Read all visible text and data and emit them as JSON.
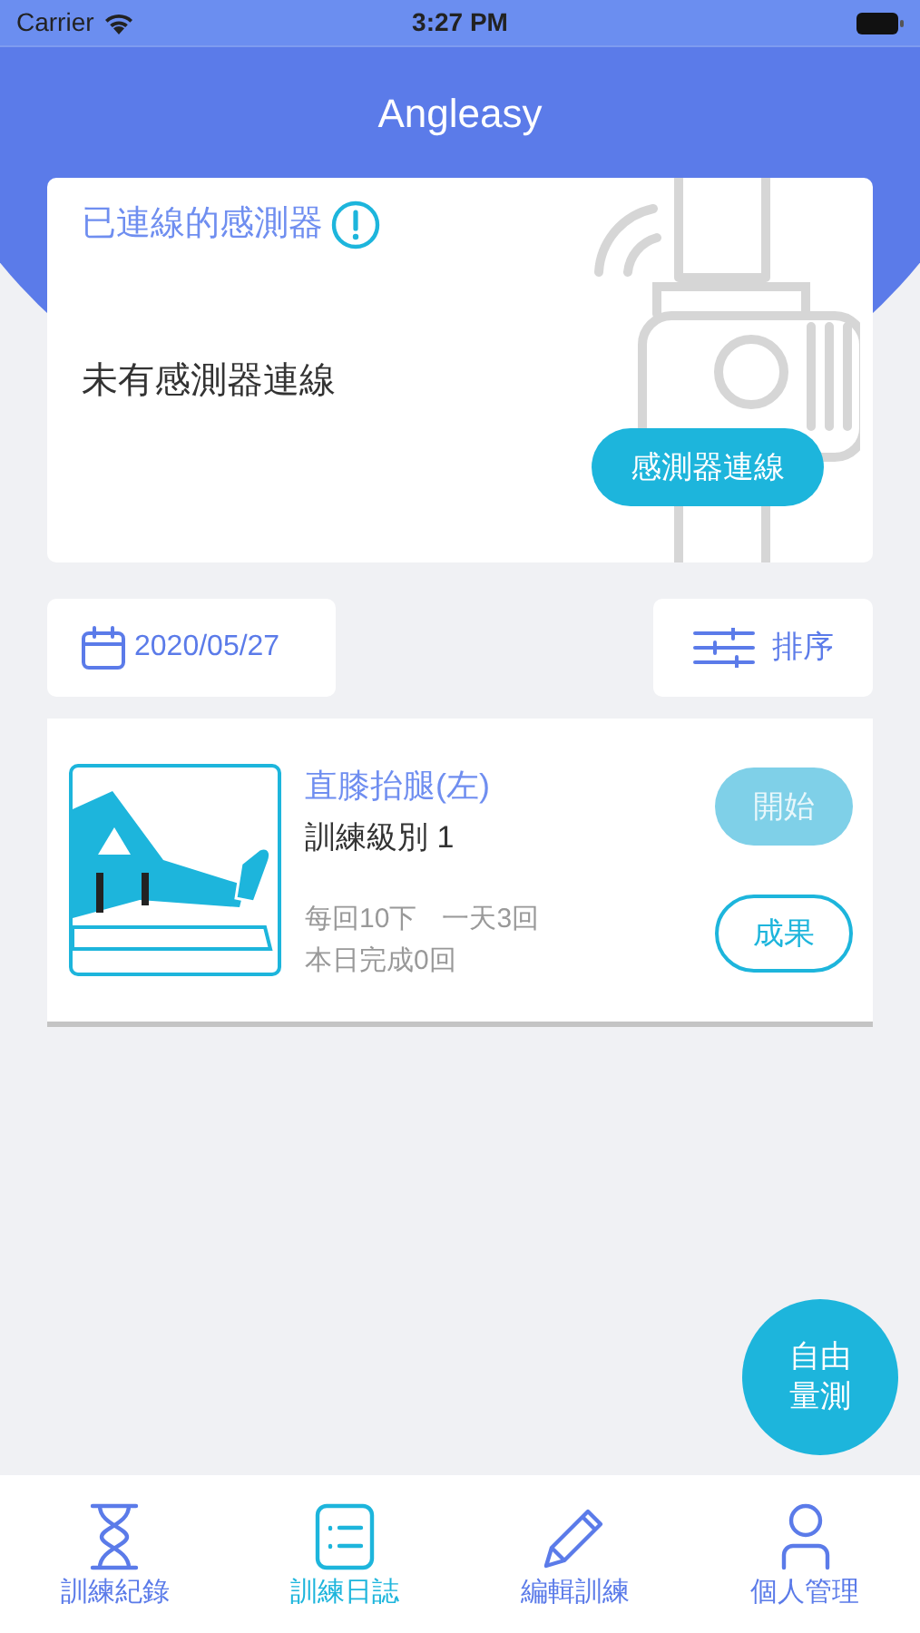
{
  "status_bar": {
    "carrier": "Carrier",
    "time": "3:27 PM"
  },
  "header": {
    "title": "Angleasy"
  },
  "sensor_card": {
    "title": "已連線的感測器",
    "message": "未有感測器連線",
    "button": "感測器連線"
  },
  "toolbar": {
    "date": "2020/05/27",
    "sort": "排序"
  },
  "exercises": [
    {
      "name": "直膝抬腿(左)",
      "level": "訓練級別 1",
      "reps": "每回10下",
      "frequency": "一天3回",
      "done": "本日完成0回",
      "start": {
        "label": "開始",
        "disabled": true
      },
      "results": "成果"
    }
  ],
  "fab": {
    "label_line1": "自由",
    "label_line2": "量測"
  },
  "tabs": [
    {
      "label": "訓練紀錄",
      "kind": "hourglass",
      "selected": false
    },
    {
      "label": "訓練日誌",
      "kind": "list",
      "selected": true
    },
    {
      "label": "編輯訓練",
      "kind": "pencil",
      "selected": false
    },
    {
      "label": "個人管理",
      "kind": "person",
      "selected": false
    }
  ]
}
